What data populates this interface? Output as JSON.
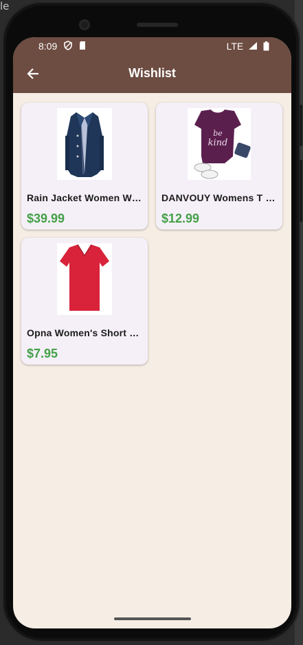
{
  "status_bar": {
    "time": "8:09",
    "network": "LTE"
  },
  "appbar": {
    "title": "Wishlist",
    "back_icon": "arrow-back-icon"
  },
  "items": [
    {
      "name": "Rain Jacket Women Windbreaker Striped Climbing Raincoats",
      "price": "$39.99",
      "image": "navy-rain-jacket"
    },
    {
      "name": "DANVOUY Womens T Shirt Casual Cotton Short",
      "price": "$12.99",
      "image": "purple-be-kind-tshirt"
    },
    {
      "name": "Opna Women's Short Sleeve Moisture",
      "price": "$7.95",
      "image": "red-vneck-tshirt"
    }
  ],
  "colors": {
    "appbar": "#6d4c41",
    "background": "#f6ede4",
    "card": "#f5f0f8",
    "price": "#43a047"
  }
}
